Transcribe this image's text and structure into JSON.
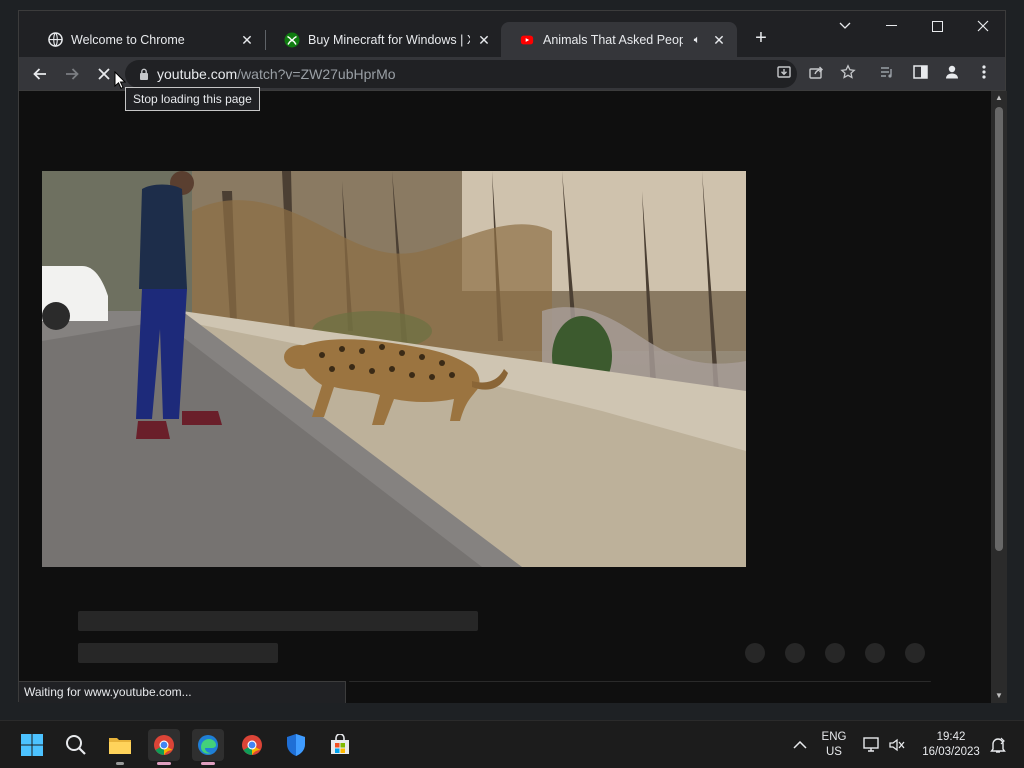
{
  "browser": {
    "tabs": [
      {
        "title": "Welcome to Chrome",
        "favicon": "globe-icon"
      },
      {
        "title": "Buy Minecraft for Windows | Xbox",
        "favicon": "xbox-icon"
      },
      {
        "title": "Animals That Asked People",
        "favicon": "youtube-icon",
        "audio": true
      }
    ],
    "new_tab": "+",
    "address": {
      "host": "youtube.com",
      "path": "/watch?v=ZW27ubHprMo"
    },
    "tooltip": "Stop loading this page",
    "status": "Waiting for www.youtube.com..."
  },
  "taskbar": {
    "language": {
      "line1": "ENG",
      "line2": "US"
    },
    "clock": {
      "time": "19:42",
      "date": "16/03/2023"
    }
  },
  "colors": {
    "accent": "#e8eaed",
    "page_bg": "#0f0f0f",
    "skeleton": "#272727"
  }
}
